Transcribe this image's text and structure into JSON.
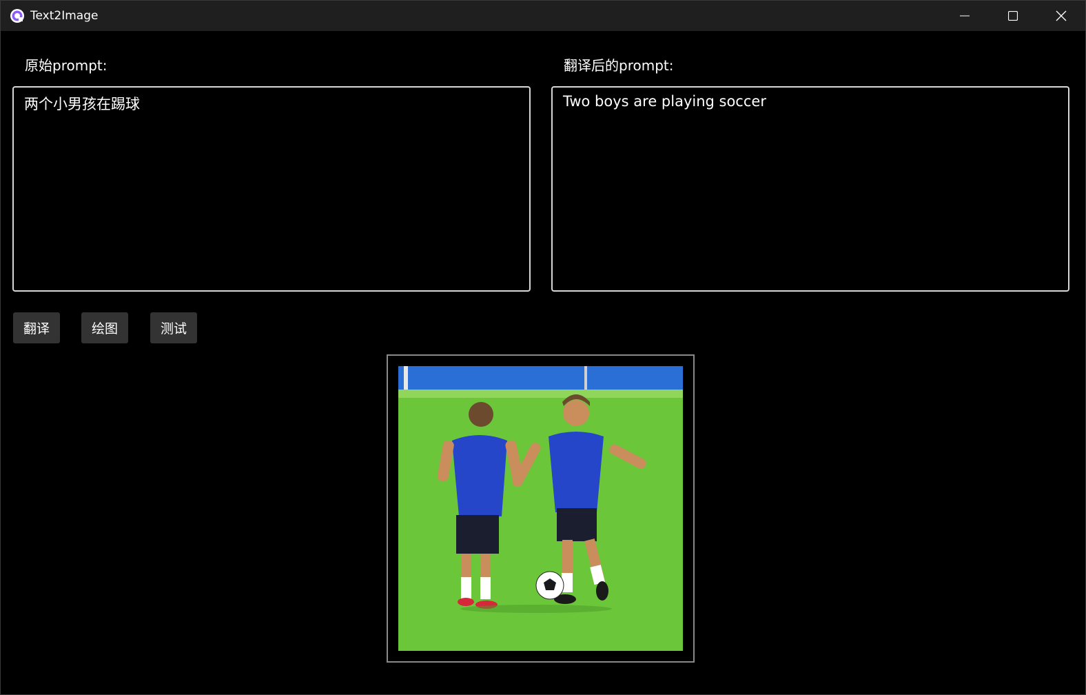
{
  "window": {
    "title": "Text2Image",
    "controls": {
      "minimize_icon": "minimize-icon",
      "maximize_icon": "maximize-icon",
      "close_icon": "close-icon"
    }
  },
  "left_panel": {
    "label": "原始prompt:",
    "value": "两个小男孩在踢球"
  },
  "right_panel": {
    "label": "翻译后的prompt:",
    "value": "Two boys are playing soccer"
  },
  "buttons": {
    "translate": "翻译",
    "draw": "绘图",
    "test": "测试"
  },
  "colors": {
    "background": "#000000",
    "titlebar": "#1f1f1f",
    "button": "#333333",
    "textbox_border": "#d8d8d8",
    "app_icon_accent": "#8b5cf6"
  }
}
